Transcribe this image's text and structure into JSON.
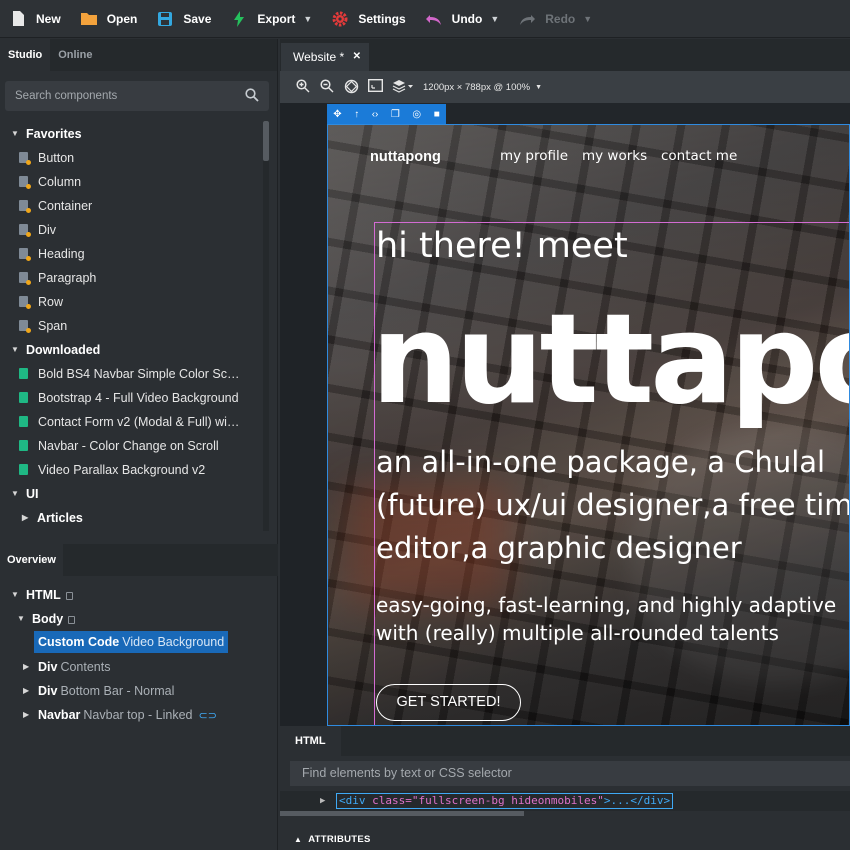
{
  "toolbar": {
    "items": [
      {
        "label": "New",
        "icon": "new-file-icon",
        "color": "#e8e8e8",
        "caret": false
      },
      {
        "label": "Open",
        "icon": "folder-icon",
        "color": "#f3a23c",
        "caret": false
      },
      {
        "label": "Save",
        "icon": "save-icon",
        "color": "#33a8e0",
        "caret": false
      },
      {
        "label": "Export",
        "icon": "bolt-icon",
        "color": "#25c15d",
        "caret": true
      },
      {
        "label": "Settings",
        "icon": "gear-icon",
        "color": "#e33a3a",
        "caret": false
      },
      {
        "label": "Undo",
        "icon": "undo-icon",
        "color": "#d267ca",
        "caret": true
      },
      {
        "label": "Redo",
        "icon": "redo-icon",
        "color": "#6e7378",
        "caret": true,
        "disabled": true
      }
    ]
  },
  "left_panel": {
    "tabs": [
      "Studio",
      "Online"
    ],
    "search_placeholder": "Search components",
    "favorites_label": "Favorites",
    "favorites": [
      "Button",
      "Column",
      "Container",
      "Div",
      "Heading",
      "Paragraph",
      "Row",
      "Span"
    ],
    "downloaded_label": "Downloaded",
    "downloaded": [
      "Bold BS4 Navbar Simple Color Sc…",
      "Bootstrap 4 - Full Video Background",
      "Contact Form v2 (Modal & Full) wi…",
      "Navbar - Color Change on Scroll",
      "Video Parallax Background v2"
    ],
    "ui_label": "UI",
    "articles_label": "Articles"
  },
  "overview": {
    "tab": "Overview",
    "html": "HTML",
    "body": "Body",
    "selected_name": "Custom Code",
    "selected_desc": "Video Background",
    "rows": [
      {
        "name": "Div",
        "desc": "Contents"
      },
      {
        "name": "Div",
        "desc": "Bottom Bar - Normal"
      },
      {
        "name": "Navbar",
        "desc": "Navbar top - Linked"
      }
    ]
  },
  "canvas": {
    "tab_label": "Website *",
    "size_label": "1200px × 788px @ 100%"
  },
  "preview": {
    "brand": "nuttapong",
    "links": [
      "my profile",
      "my works",
      "contact me"
    ],
    "greeting": "hi there! meet",
    "name": "nuttapo",
    "tagline_lines": [
      "an all-in-one package, a Chulal",
      "(future) ux/ui designer,a free tim",
      "editor,a graphic designer"
    ],
    "sub_lines": [
      "easy-going, fast-learning, and highly adaptive",
      "with (really) multiple all-rounded talents"
    ],
    "cta": "GET STARTED!"
  },
  "bottom_panel": {
    "tab": "HTML",
    "search_placeholder": "Find elements by text or CSS selector",
    "code_open": "<div",
    "code_attr": " class=",
    "code_val": "\"fullscreen-bg hideonmobiles\"",
    "code_close": ">...</div>",
    "attributes_label": "ATTRIBUTES"
  }
}
